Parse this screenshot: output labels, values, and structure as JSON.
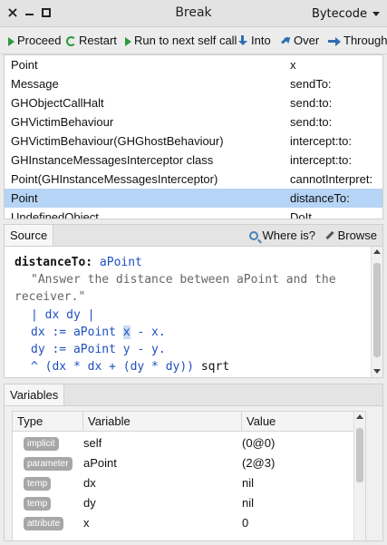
{
  "window": {
    "title": "Break",
    "mode": "Bytecode"
  },
  "toolbar": {
    "proceed": "Proceed",
    "restart": "Restart",
    "run_to_next": "Run to next self call",
    "into": "Into",
    "over": "Over",
    "through": "Through"
  },
  "stack": [
    {
      "receiver": "Point",
      "selector": "x"
    },
    {
      "receiver": "Message",
      "selector": "sendTo:"
    },
    {
      "receiver": "GHObjectCallHalt",
      "selector": "send:to:"
    },
    {
      "receiver": "GHVictimBehaviour",
      "selector": "send:to:"
    },
    {
      "receiver": "GHVictimBehaviour(GHGhostBehaviour)",
      "selector": "intercept:to:"
    },
    {
      "receiver": "GHInstanceMessagesInterceptor class",
      "selector": "intercept:to:"
    },
    {
      "receiver": "Point(GHInstanceMessagesInterceptor)",
      "selector": "cannotInterpret:"
    },
    {
      "receiver": "Point",
      "selector": "distanceTo:",
      "selected": true
    },
    {
      "receiver": "UndefinedObject",
      "selector": "DoIt"
    }
  ],
  "source": {
    "tab": "Source",
    "where_is": "Where is?",
    "browse": "Browse",
    "lines": {
      "l1_selector": "distanceTo:",
      "l1_arg": "aPoint",
      "l2": "\"Answer the distance between aPoint and the",
      "l3": "receiver.\"",
      "l4_a": "| ",
      "l4_b": "dx dy",
      "l4_c": " |",
      "l5_a": "dx := aPoint ",
      "l5_sel": "x",
      "l5_b": " - x.",
      "l6": "dy := aPoint y - y.",
      "l7_a": "^ (dx * dx + (dy * dy)) ",
      "l7_b": "sqrt"
    }
  },
  "variables": {
    "tab": "Variables",
    "headers": {
      "type": "Type",
      "variable": "Variable",
      "value": "Value"
    },
    "rows": [
      {
        "type": "implicit",
        "name": "self",
        "value": "(0@0)"
      },
      {
        "type": "parameter",
        "name": "aPoint",
        "value": "(2@3)"
      },
      {
        "type": "temp",
        "name": "dx",
        "value": "nil"
      },
      {
        "type": "temp",
        "name": "dy",
        "value": "nil"
      },
      {
        "type": "attribute",
        "name": "x",
        "value": "0"
      }
    ]
  }
}
